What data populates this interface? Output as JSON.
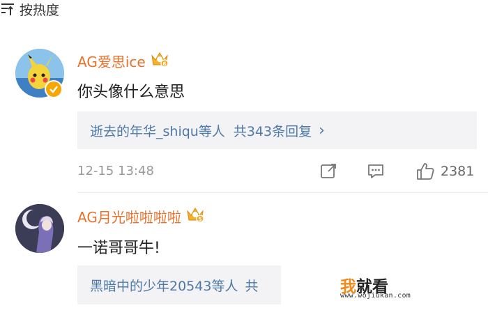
{
  "sort": {
    "label": "按热度",
    "icon": "sort-icon"
  },
  "comments": [
    {
      "username": "AG爱思ice",
      "text": "你头像什么意思",
      "replies_users": "逝去的年华_shiqu等人",
      "replies_count": "共343条回复",
      "chevron": "›",
      "timestamp": "12-15 13:48",
      "likes": "2381"
    },
    {
      "username": "AG月光啦啦啦啦",
      "text": "一诺哥哥牛!",
      "replies_users": "黑暗中的少年20543等人",
      "replies_count": "共"
    }
  ],
  "watermark": {
    "char1": "我",
    "char2": "就看",
    "url": "www.wojiukan.com"
  },
  "colors": {
    "username": "#e8712b",
    "link": "#4d79a8",
    "meta": "#999999",
    "reply_bg": "#f3f3f5"
  }
}
